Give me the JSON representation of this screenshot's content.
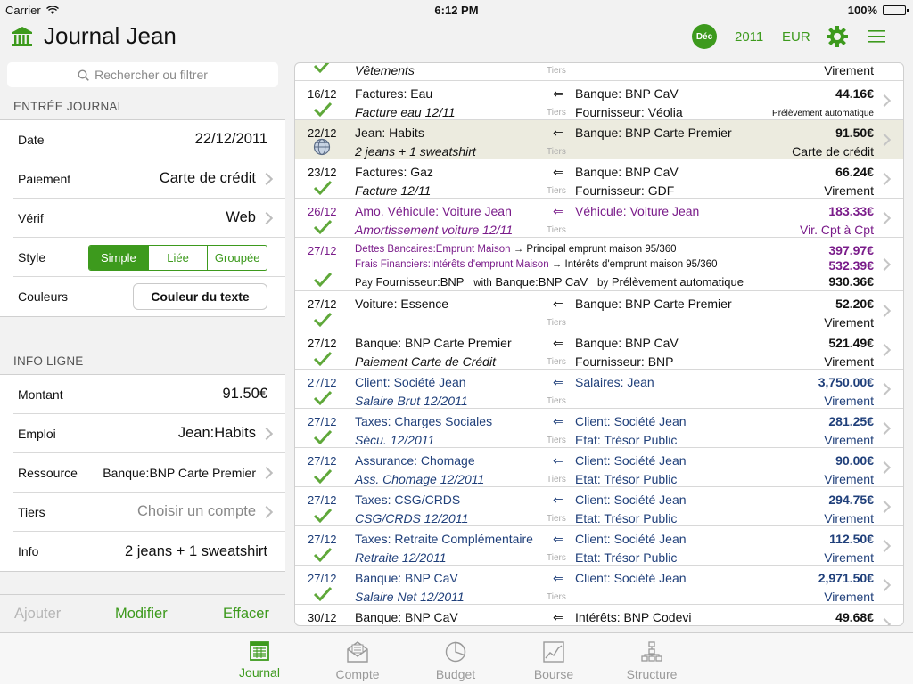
{
  "status": {
    "carrier": "Carrier",
    "time": "6:12 PM",
    "battery": "100%"
  },
  "header": {
    "title_main": "Journal",
    "title_user": "Jean",
    "month": "Déc",
    "year": "2011",
    "currency": "EUR"
  },
  "search": {
    "placeholder": "Rechercher ou filtrer"
  },
  "entree": {
    "section": "ENTRÉE JOURNAL",
    "date_label": "Date",
    "date_value": "22/12/2011",
    "paiement_label": "Paiement",
    "paiement_value": "Carte de crédit",
    "verif_label": "Vérif",
    "verif_value": "Web",
    "style_label": "Style",
    "style_options": [
      "Simple",
      "Liée",
      "Groupée"
    ],
    "couleurs_label": "Couleurs",
    "couleurs_button": "Couleur du texte"
  },
  "ligne": {
    "section": "INFO LIGNE",
    "montant_label": "Montant",
    "montant_value": "91.50€",
    "emploi_label": "Emploi",
    "emploi_value": "Jean:Habits",
    "ressource_label": "Ressource",
    "ressource_value": "Banque:BNP Carte Premier",
    "tiers_label": "Tiers",
    "tiers_value": "Choisir un compte",
    "info_label": "Info",
    "info_value": "2 jeans + 1 sweatshirt"
  },
  "actions": {
    "add": "Ajouter",
    "modify": "Modifier",
    "delete": "Effacer"
  },
  "journal": {
    "arrow": "⇐",
    "tiers_tag": "Tiers",
    "first": {
      "memo": "Vêtements",
      "payment": "Virement"
    },
    "entries": [
      {
        "date": "16/12",
        "acc1": "Factures: Eau",
        "acc2": "Banque: BNP CaV",
        "amount": "44.16€",
        "memo": "Facture eau 12/11",
        "payee": "Fournisseur: Véolia",
        "payment": "Prélèvement automatique"
      },
      {
        "date": "22/12",
        "acc1": "Jean: Habits",
        "acc2": "Banque: BNP Carte Premier",
        "amount": "91.50€",
        "memo": "2 jeans + 1 sweatshirt",
        "payee": "",
        "payment": "Carte de crédit"
      },
      {
        "date": "23/12",
        "acc1": "Factures: Gaz",
        "acc2": "Banque: BNP CaV",
        "amount": "66.24€",
        "memo": "Facture 12/11",
        "payee": "Fournisseur: GDF",
        "payment": "Virement"
      },
      {
        "date": "26/12",
        "acc1": "Amo. Véhicule: Voiture Jean",
        "acc2": "Véhicule: Voiture Jean",
        "amount": "183.33€",
        "memo": "Amortissement voiture 12/11",
        "payee": "",
        "payment": "Vir. Cpt à Cpt"
      }
    ],
    "split": {
      "date": "27/12",
      "line1_acc": "Dettes Bancaires:Emprunt Maison",
      "line1_arrow": "→",
      "line1_desc": "Principal emprunt maison 95/360",
      "line1_amount": "397.97€",
      "line2_acc": "Frais Financiers:Intérêts d'emprunt Maison",
      "line2_arrow": "→",
      "line2_desc": "Intérêts d'emprunt maison 95/360",
      "line2_amount": "532.39€",
      "pay_label": "Pay",
      "pay_value": "Fournisseur:BNP",
      "with_label": "with",
      "with_value": "Banque:BNP CaV",
      "by_label": "by",
      "by_value": "Prélèvement automatique",
      "total": "930.36€"
    },
    "entries2": [
      {
        "date": "27/12",
        "acc1": "Voiture: Essence",
        "acc2": "Banque: BNP Carte Premier",
        "amount": "52.20€",
        "memo": "",
        "payee": "",
        "payment": "Virement"
      },
      {
        "date": "27/12",
        "acc1": "Banque: BNP Carte Premier",
        "acc2": "Banque: BNP CaV",
        "amount": "521.49€",
        "memo": "Paiement Carte de Crédit",
        "payee": "Fournisseur: BNP",
        "payment": "Virement"
      },
      {
        "date": "27/12",
        "acc1": "Client: Société Jean",
        "acc2": "Salaires: Jean",
        "amount": "3,750.00€",
        "memo": "Salaire Brut 12/2011",
        "payee": "",
        "payment": "Virement"
      },
      {
        "date": "27/12",
        "acc1": "Taxes: Charges Sociales",
        "acc2": "Client: Société Jean",
        "amount": "281.25€",
        "memo": "Sécu. 12/2011",
        "payee": "Etat: Trésor Public",
        "payment": "Virement"
      },
      {
        "date": "27/12",
        "acc1": "Assurance: Chomage",
        "acc2": "Client: Société Jean",
        "amount": "90.00€",
        "memo": "Ass. Chomage 12/2011",
        "payee": "Etat: Trésor Public",
        "payment": "Virement"
      },
      {
        "date": "27/12",
        "acc1": "Taxes: CSG/CRDS",
        "acc2": "Client: Société Jean",
        "amount": "294.75€",
        "memo": "CSG/CRDS 12/2011",
        "payee": "Etat: Trésor Public",
        "payment": "Virement"
      },
      {
        "date": "27/12",
        "acc1": "Taxes: Retraite Complémentaire",
        "acc2": "Client: Société Jean",
        "amount": "112.50€",
        "memo": "Retraite 12/2011",
        "payee": "Etat: Trésor Public",
        "payment": "Virement"
      },
      {
        "date": "27/12",
        "acc1": "Banque: BNP CaV",
        "acc2": "Client: Société Jean",
        "amount": "2,971.50€",
        "memo": "Salaire Net 12/2011",
        "payee": "",
        "payment": "Virement"
      },
      {
        "date": "30/12",
        "acc1": "Banque: BNP CaV",
        "acc2": "Intérêts: BNP Codevi",
        "amount": "49.68€",
        "memo": "",
        "payee": "",
        "payment": ""
      }
    ]
  },
  "tabs": [
    "Journal",
    "Compte",
    "Budget",
    "Bourse",
    "Structure"
  ],
  "colors": {
    "accent": "#3d9a1d",
    "blue_text": "#1f3f7a",
    "purple_text": "#7a1c8a",
    "selected_row": "#ecebdf"
  }
}
